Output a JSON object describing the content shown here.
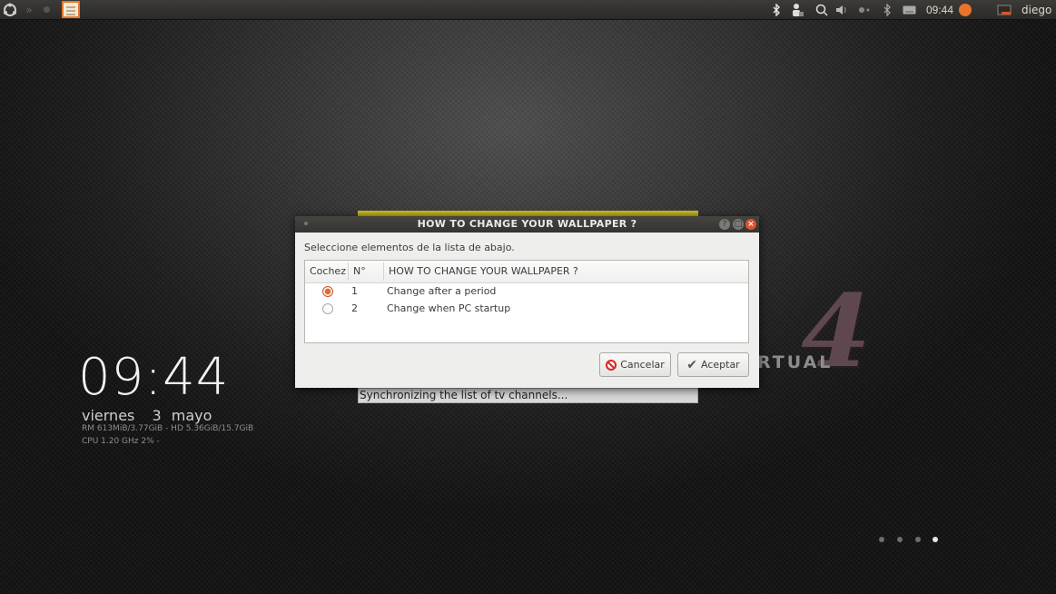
{
  "panel": {
    "clock": "09:44",
    "user": "diego"
  },
  "conky": {
    "time": "09:44",
    "weekday": "viernes",
    "day": "3",
    "month": "mayo",
    "stats_line": "RM 613MiB/3.77GiB - HD 5.36GiB/15.7GiB",
    "cpu_line": "CPU 1.20 GHz 2% -"
  },
  "logo": {
    "numeral": "4",
    "text": "RTUAL"
  },
  "background_progress": {
    "status": "Synchronizing the list of tv channels..."
  },
  "dialog": {
    "title": "HOW TO CHANGE YOUR WALLPAPER ?",
    "prompt": "Seleccione elementos de la lista de abajo.",
    "columns": [
      "Cochez",
      "N°",
      "HOW TO CHANGE YOUR WALLPAPER ?"
    ],
    "rows": [
      {
        "number": "1",
        "label": "Change after a period",
        "checked": true
      },
      {
        "number": "2",
        "label": "Change when PC startup",
        "checked": false
      }
    ],
    "cancel_label": "Cancelar",
    "accept_label": "Aceptar"
  },
  "workspace_dots": {
    "count": 4,
    "active_index": 3
  },
  "colors": {
    "accent": "#e16a2e",
    "close_button": "#e0532a",
    "progress_yellow": "#cfc226"
  }
}
